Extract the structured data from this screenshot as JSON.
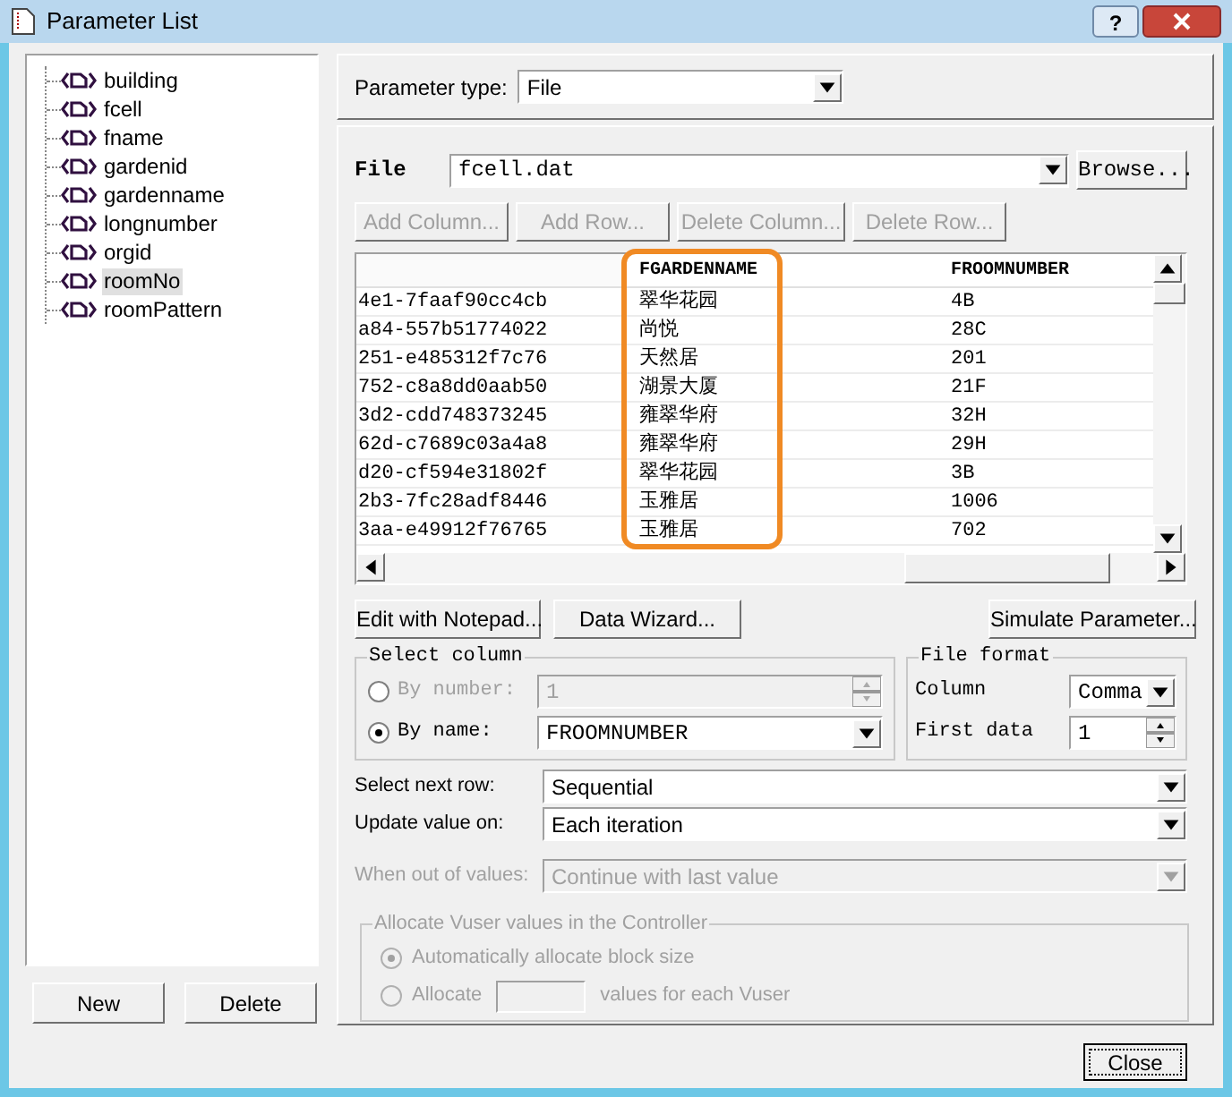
{
  "window": {
    "title": "Parameter List",
    "help": "?"
  },
  "parameters": [
    {
      "label": "building",
      "selected": false
    },
    {
      "label": "fcell",
      "selected": false
    },
    {
      "label": "fname",
      "selected": false
    },
    {
      "label": "gardenid",
      "selected": false
    },
    {
      "label": "gardenname",
      "selected": false
    },
    {
      "label": "longnumber",
      "selected": false
    },
    {
      "label": "orgid",
      "selected": false
    },
    {
      "label": "roomNo",
      "selected": true
    },
    {
      "label": "roomPattern",
      "selected": false
    }
  ],
  "list_buttons": [
    "New",
    "Delete"
  ],
  "parameter_type": {
    "label": "Parameter type:",
    "value": "File"
  },
  "file": {
    "label": "File",
    "value": "fcell.dat",
    "browse": "Browse..."
  },
  "table_actions": [
    {
      "label": "Add Column...",
      "disabled": true
    },
    {
      "label": "Add Row...",
      "disabled": true
    },
    {
      "label": "Delete Column...",
      "disabled": true
    },
    {
      "label": "Delete Row...",
      "disabled": true
    }
  ],
  "table": {
    "columns": [
      {
        "highlighted": false
      },
      {
        "label": "FGARDENNAME",
        "highlighted": true
      },
      {
        "label": "FROOMNUMBER",
        "highlighted": false
      }
    ],
    "rows": [
      [
        "4e1-7faaf90cc4cb",
        "翠华花园",
        "4B"
      ],
      [
        "a84-557b51774022",
        "尚悦",
        "28C"
      ],
      [
        "251-e485312f7c76",
        "天然居",
        "201"
      ],
      [
        "752-c8a8dd0aab50",
        "湖景大厦",
        "21F"
      ],
      [
        "3d2-cdd748373245",
        "雍翠华府",
        "32H"
      ],
      [
        "62d-c7689c03a4a8",
        "雍翠华府",
        "29H"
      ],
      [
        "d20-cf594e31802f",
        "翠华花园",
        "3B"
      ],
      [
        "2b3-7fc28adf8446",
        "玉雅居",
        "1006"
      ],
      [
        "3aa-e49912f76765",
        "玉雅居",
        "702"
      ]
    ]
  },
  "file_actions": [
    "Edit with Notepad...",
    "Data Wizard...",
    "Simulate Parameter..."
  ],
  "select_column": {
    "title": "Select column",
    "options": [
      {
        "kind": "spin",
        "label": "By number:",
        "value": "1",
        "selected": false,
        "disabled": true
      },
      {
        "kind": "combo",
        "label": "By name:",
        "value": "FROOMNUMBER",
        "selected": true,
        "disabled": false
      }
    ]
  },
  "file_format": {
    "title": "File format",
    "column": {
      "label": "Column",
      "value": "Comma"
    },
    "first_data": {
      "label": "First data",
      "value": "1"
    }
  },
  "row_settings": [
    {
      "label": "Select next row:",
      "value": "Sequential",
      "disabled": false
    },
    {
      "label": "Update value on:",
      "value": "Each iteration",
      "disabled": false
    },
    {
      "label": "When out of values:",
      "value": "Continue with last value",
      "disabled": true
    }
  ],
  "allocate": {
    "title": "Allocate Vuser values in the Controller",
    "disabled": true,
    "options": [
      {
        "kind": "plain",
        "label": "Automatically allocate block size",
        "selected": true
      },
      {
        "kind": "count",
        "label": "Allocate",
        "suffix": "values for each Vuser",
        "selected": false
      }
    ]
  },
  "close_button": "Close"
}
